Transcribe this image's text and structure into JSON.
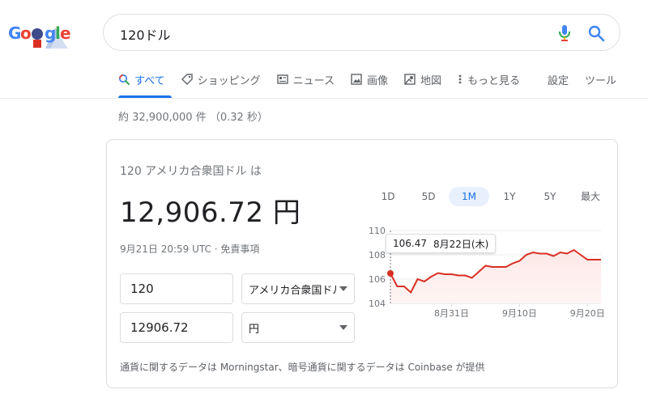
{
  "search": {
    "query": "120ドル"
  },
  "tabs": [
    {
      "label": "すべて",
      "icon": "search-icon"
    },
    {
      "label": "ショッピング",
      "icon": "tag-icon"
    },
    {
      "label": "ニュース",
      "icon": "news-icon"
    },
    {
      "label": "画像",
      "icon": "image-icon"
    },
    {
      "label": "地図",
      "icon": "map-icon"
    },
    {
      "label": "もっと見る",
      "icon": "more-vert-icon"
    },
    {
      "label": "設定"
    },
    {
      "label": "ツール"
    }
  ],
  "result_stats": "約 32,900,000 件 （0.32 秒）",
  "converter": {
    "from_label": "120 アメリカ合衆国ドル は",
    "result": "12,906.72 円",
    "timestamp": "9月21日 20:59 UTC · 免責事項",
    "from_amount": "120",
    "from_currency": "アメリカ合衆国ドル",
    "to_amount": "12906.72",
    "to_currency": "円",
    "footer": "通貨に関するデータは Morningstar、暗号通貨に関するデータは Coinbase が提供"
  },
  "ranges": [
    "1D",
    "5D",
    "1M",
    "1Y",
    "5Y",
    "最大"
  ],
  "active_range": "1M",
  "tooltip": {
    "value": "106.47",
    "date": "8月22日(木)"
  },
  "chart_data": {
    "type": "area",
    "y_ticks": [
      "110",
      "108",
      "106",
      "104"
    ],
    "x_ticks": [
      "8月31日",
      "9月10日",
      "9月20日"
    ],
    "ylim": [
      104,
      110
    ],
    "x": [
      0,
      1,
      2,
      3,
      4,
      5,
      6,
      7,
      8,
      9,
      10,
      11,
      12,
      13,
      14,
      15,
      16,
      17,
      18,
      19,
      20,
      21,
      22,
      23,
      24,
      25,
      26,
      27,
      28,
      29,
      30,
      31
    ],
    "values": [
      106.47,
      105.4,
      105.4,
      104.9,
      106.0,
      105.8,
      106.2,
      106.5,
      106.4,
      106.4,
      106.3,
      106.3,
      106.1,
      106.6,
      107.1,
      107.0,
      107.0,
      107.0,
      107.3,
      107.5,
      108.0,
      108.2,
      108.1,
      108.1,
      107.9,
      108.2,
      108.1,
      108.4,
      108.0,
      107.6,
      107.6,
      107.6
    ],
    "x_tick_index": [
      9,
      19,
      29
    ],
    "color": "#d93025"
  }
}
